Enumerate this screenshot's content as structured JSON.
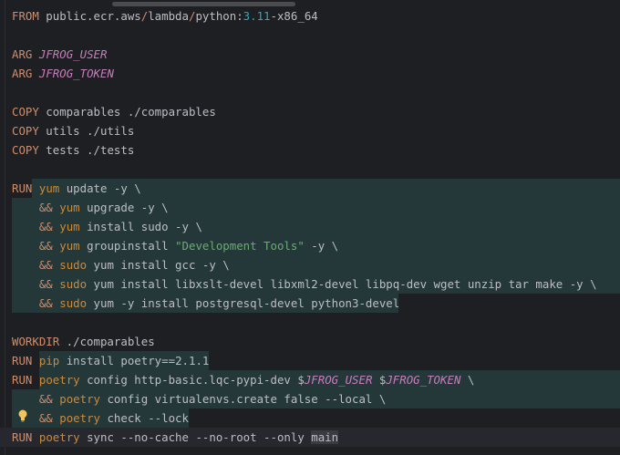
{
  "editor": {
    "lines": [
      [
        {
          "t": "FROM",
          "c": "kw"
        },
        {
          "t": " public.ecr.aws",
          "c": "plain"
        },
        {
          "t": "/",
          "c": "kw"
        },
        {
          "t": "lambda",
          "c": "plain"
        },
        {
          "t": "/",
          "c": "kw"
        },
        {
          "t": "python:",
          "c": "plain"
        },
        {
          "t": "3.11",
          "c": "num"
        },
        {
          "t": "-x86_64",
          "c": "plain"
        }
      ],
      [],
      [
        {
          "t": "ARG",
          "c": "kw"
        },
        {
          "t": " ",
          "c": "plain"
        },
        {
          "t": "JFROG_USER",
          "c": "var"
        }
      ],
      [
        {
          "t": "ARG",
          "c": "kw"
        },
        {
          "t": " ",
          "c": "plain"
        },
        {
          "t": "JFROG_TOKEN",
          "c": "var"
        }
      ],
      [],
      [
        {
          "t": "COPY",
          "c": "kw"
        },
        {
          "t": " comparables ./comparables",
          "c": "plain"
        }
      ],
      [
        {
          "t": "COPY",
          "c": "kw"
        },
        {
          "t": " utils ./utils",
          "c": "plain"
        }
      ],
      [
        {
          "t": "COPY",
          "c": "kw"
        },
        {
          "t": " tests ./tests",
          "c": "plain"
        }
      ],
      [],
      [
        {
          "t": "RUN",
          "c": "kw"
        },
        {
          "t": " ",
          "c": "plain"
        },
        {
          "t": "yum",
          "c": "cmd"
        },
        {
          "t": " update -y \\",
          "c": "plain"
        }
      ],
      [
        {
          "t": "    &&",
          "c": "kw"
        },
        {
          "t": " ",
          "c": "plain"
        },
        {
          "t": "yum",
          "c": "cmd"
        },
        {
          "t": " upgrade -y \\",
          "c": "plain"
        }
      ],
      [
        {
          "t": "    &&",
          "c": "kw"
        },
        {
          "t": " ",
          "c": "plain"
        },
        {
          "t": "yum",
          "c": "cmd"
        },
        {
          "t": " install sudo -y \\",
          "c": "plain"
        }
      ],
      [
        {
          "t": "    &&",
          "c": "kw"
        },
        {
          "t": " ",
          "c": "plain"
        },
        {
          "t": "yum",
          "c": "cmd"
        },
        {
          "t": " groupinstall ",
          "c": "plain"
        },
        {
          "t": "\"Development Tools\"",
          "c": "str"
        },
        {
          "t": " -y \\",
          "c": "plain"
        }
      ],
      [
        {
          "t": "    &&",
          "c": "kw"
        },
        {
          "t": " ",
          "c": "plain"
        },
        {
          "t": "sudo",
          "c": "cmd"
        },
        {
          "t": " yum install gcc -y \\",
          "c": "plain"
        }
      ],
      [
        {
          "t": "    &&",
          "c": "kw"
        },
        {
          "t": " ",
          "c": "plain"
        },
        {
          "t": "sudo",
          "c": "cmd"
        },
        {
          "t": " yum install libxslt-devel libxml2-devel libpq-dev wget unzip tar make -y \\",
          "c": "plain"
        }
      ],
      [
        {
          "t": "    &&",
          "c": "kw"
        },
        {
          "t": " ",
          "c": "plain"
        },
        {
          "t": "sudo",
          "c": "cmd"
        },
        {
          "t": " yum -y install postgresql-devel python3-devel",
          "c": "plain"
        }
      ],
      [],
      [
        {
          "t": "WORKDIR",
          "c": "kw"
        },
        {
          "t": " ./comparables",
          "c": "plain"
        }
      ],
      [
        {
          "t": "RUN",
          "c": "kw"
        },
        {
          "t": " ",
          "c": "plain"
        },
        {
          "t": "pip",
          "c": "cmd"
        },
        {
          "t": " install poetry==2.1.1",
          "c": "plain"
        }
      ],
      [
        {
          "t": "RUN",
          "c": "kw"
        },
        {
          "t": " ",
          "c": "plain"
        },
        {
          "t": "poetry",
          "c": "cmd"
        },
        {
          "t": " config http-basic.lqc-pypi-dev $",
          "c": "plain"
        },
        {
          "t": "JFROG_USER",
          "c": "var"
        },
        {
          "t": " $",
          "c": "plain"
        },
        {
          "t": "JFROG_TOKEN",
          "c": "var"
        },
        {
          "t": " \\",
          "c": "plain"
        }
      ],
      [
        {
          "t": "    &&",
          "c": "kw"
        },
        {
          "t": " ",
          "c": "plain"
        },
        {
          "t": "poetry",
          "c": "cmd"
        },
        {
          "t": " config virtualenvs.create false --local \\",
          "c": "plain"
        }
      ],
      [
        {
          "t": "    &&",
          "c": "kw"
        },
        {
          "t": " ",
          "c": "plain"
        },
        {
          "t": "poetry",
          "c": "cmd"
        },
        {
          "t": " check --lock",
          "c": "plain"
        }
      ],
      [
        {
          "t": "RUN",
          "c": "kw"
        },
        {
          "t": " ",
          "c": "plain"
        },
        {
          "t": "poetry",
          "c": "cmd"
        },
        {
          "t": " sync --no-cache --no-root --only ",
          "c": "plain"
        },
        {
          "t": "main",
          "c": "sel"
        }
      ]
    ]
  }
}
